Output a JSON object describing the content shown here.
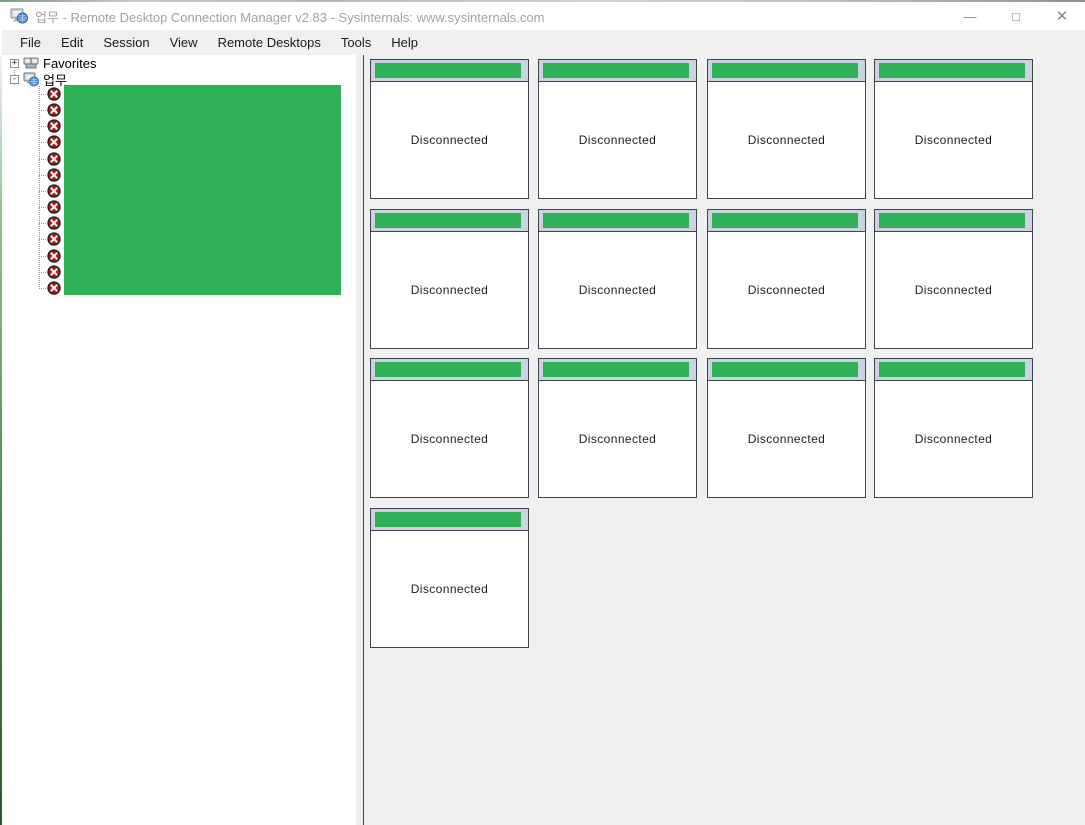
{
  "window": {
    "title": "업무 - Remote Desktop Connection Manager v2.83 - Sysinternals: www.sysinternals.com",
    "controls": [
      {
        "name": "minimize",
        "glyph": "—"
      },
      {
        "name": "maximize",
        "glyph": "□"
      },
      {
        "name": "close",
        "glyph": "✕"
      }
    ]
  },
  "menu": {
    "items": [
      "File",
      "Edit",
      "Session",
      "View",
      "Remote Desktops",
      "Tools",
      "Help"
    ]
  },
  "tree": {
    "favorites": {
      "label": "Favorites",
      "expand_glyph": "+",
      "expand_state": "collapsed",
      "icon": "favorites-group-icon"
    },
    "group": {
      "label": "업무",
      "expand_glyph": "-",
      "expand_state": "expanded",
      "icon": "server-group-icon",
      "names_redacted": true,
      "children": [
        {
          "icon": "disconnected-x-icon"
        },
        {
          "icon": "disconnected-x-icon"
        },
        {
          "icon": "disconnected-x-icon"
        },
        {
          "icon": "disconnected-x-icon"
        },
        {
          "icon": "disconnected-x-icon"
        },
        {
          "icon": "disconnected-x-icon"
        },
        {
          "icon": "disconnected-x-icon"
        },
        {
          "icon": "disconnected-x-icon"
        },
        {
          "icon": "disconnected-x-icon"
        },
        {
          "icon": "disconnected-x-icon"
        },
        {
          "icon": "disconnected-x-icon"
        },
        {
          "icon": "disconnected-x-icon"
        },
        {
          "icon": "disconnected-x-icon"
        }
      ]
    }
  },
  "grid": {
    "tiles": [
      {
        "status": "Disconnected",
        "title_redacted": true
      },
      {
        "status": "Disconnected",
        "title_redacted": true
      },
      {
        "status": "Disconnected",
        "title_redacted": true
      },
      {
        "status": "Disconnected",
        "title_redacted": true
      },
      {
        "status": "Disconnected",
        "title_redacted": true
      },
      {
        "status": "Disconnected",
        "title_redacted": true
      },
      {
        "status": "Disconnected",
        "title_redacted": true
      },
      {
        "status": "Disconnected",
        "title_redacted": true
      },
      {
        "status": "Disconnected",
        "title_redacted": true
      },
      {
        "status": "Disconnected",
        "title_redacted": true
      },
      {
        "status": "Disconnected",
        "title_redacted": true
      },
      {
        "status": "Disconnected",
        "title_redacted": true
      },
      {
        "status": "Disconnected",
        "title_redacted": true
      }
    ]
  },
  "colors": {
    "redaction_green": "#2eb157",
    "tile_header_bg": "#c9d4e0",
    "tile_border": "#42424c",
    "panel_bg": "#f0f0f0",
    "title_text": "#a2a2a2"
  }
}
